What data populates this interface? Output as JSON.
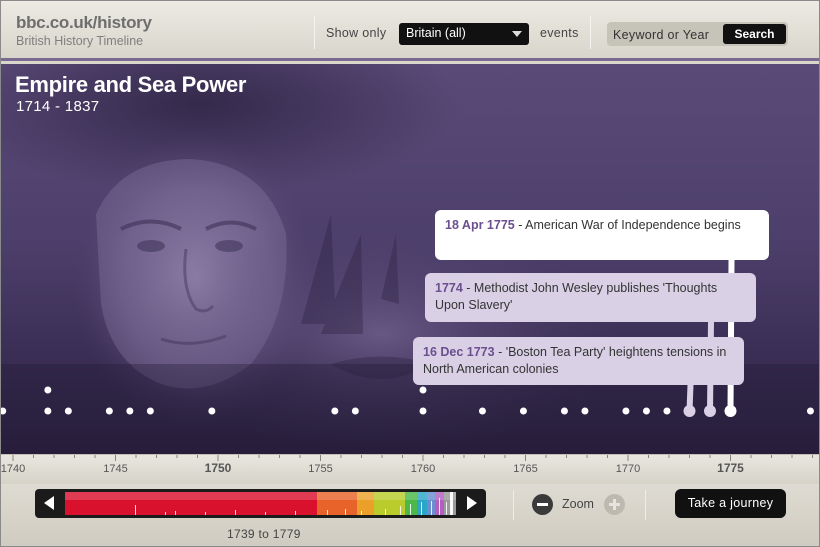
{
  "header": {
    "site": "bbc.co.uk/history",
    "subtitle": "British History Timeline",
    "show_only_label": "Show only",
    "filter_value": "Britain (all)",
    "events_label": "events",
    "search_placeholder": "Keyword or Year",
    "search_button": "Search"
  },
  "era": {
    "title": "Empire and Sea Power",
    "years": "1714 - 1837"
  },
  "events": [
    {
      "date": "18 Apr 1775",
      "text": " - American War of Independence begins"
    },
    {
      "date": "1774",
      "text": " - Methodist John Wesley publishes 'Thoughts Upon Slavery'"
    },
    {
      "date": "16 Dec 1773",
      "text": " - 'Boston Tea Party' heightens tensions in North American colonies"
    }
  ],
  "timeline": {
    "tick_labels": [
      "1740",
      "1745",
      "1750",
      "1755",
      "1760",
      "1765",
      "1770",
      "1775"
    ],
    "major_label": "1750",
    "event_years": [
      1739.5,
      1741.7,
      1742.7,
      1744.7,
      1745.7,
      1746.7,
      1749.7,
      1755.7,
      1756.7,
      1760,
      1762.9,
      1764.9,
      1766.9,
      1767.9,
      1769.9,
      1770.9,
      1771.9,
      1773,
      1774,
      1775,
      1778.9
    ],
    "stacked_years": [
      1741.7,
      1760
    ]
  },
  "footer": {
    "range_label": "1739 to 1779",
    "zoom_label": "Zoom",
    "journey_button": "Take a journey"
  },
  "colors": {
    "accent_purple": "#6b4f8e",
    "era_background": "#4d3f6b"
  }
}
